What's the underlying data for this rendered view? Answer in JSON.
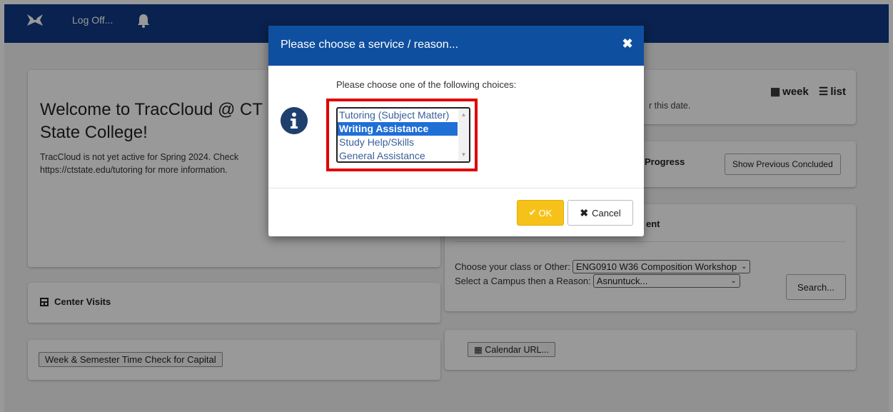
{
  "nav": {
    "logoff": "Log Off..."
  },
  "welcome": {
    "heading": "Welcome to TracCloud @ CT State College!",
    "body": "TracCloud is not yet active for Spring 2024. Check https://ctstate.edu/tutoring for more information."
  },
  "center_visits": {
    "label": "Center Visits"
  },
  "week_check": {
    "label": "Week & Semester Time Check for Capital"
  },
  "appointments": {
    "note": "r this date.",
    "week_label": "week",
    "list_label": "list"
  },
  "progress": {
    "title": "Progress",
    "show_previous_label": "Show Previous Concluded"
  },
  "booking": {
    "title": "ent",
    "class_prompt": "Choose your class or Other:",
    "class_value": "ENG0910 W36 Composition Workshop",
    "campus_prompt": "Select a Campus then a Reason:",
    "campus_value": "Asnuntuck...",
    "search_label": "Search..."
  },
  "calendar": {
    "label": "Calendar URL..."
  },
  "modal": {
    "title": "Please choose a service / reason...",
    "close": "✖",
    "prompt": "Please choose one of the following choices:",
    "options": [
      "Tutoring (Subject Matter)",
      "Writing Assistance",
      "Study Help/Skills",
      "General Assistance"
    ],
    "selected_index": 1,
    "ok_label": "OK",
    "cancel_label": "Cancel"
  },
  "colors": {
    "nav_bg": "#0f3a84",
    "modal_header": "#0f4fa0",
    "ok_button": "#f6c21a",
    "highlight_border": "#e00000",
    "selected_option": "#1f6fd6"
  }
}
